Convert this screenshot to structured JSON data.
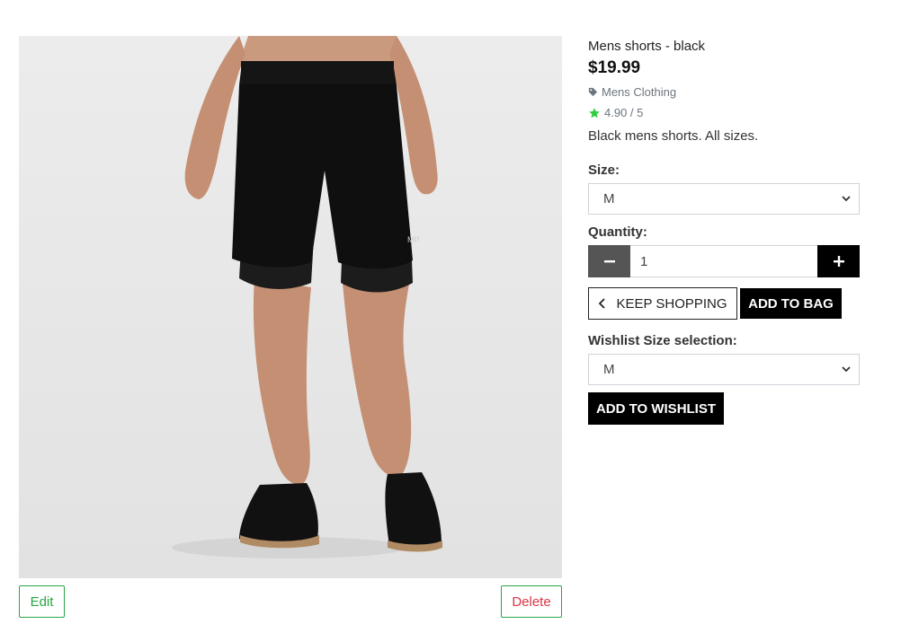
{
  "product": {
    "name": "Mens shorts - black",
    "price": "$19.99",
    "category": "Mens Clothing",
    "rating": "4.90 / 5",
    "description": "Black mens shorts. All sizes.",
    "image_icon": "product-photo"
  },
  "admin": {
    "edit_label": "Edit",
    "delete_label": "Delete"
  },
  "size": {
    "label": "Size:",
    "selected": "M"
  },
  "quantity": {
    "label": "Quantity:",
    "value": "1",
    "minus_icon": "minus-icon",
    "plus_icon": "plus-icon"
  },
  "actions": {
    "keep_shopping_label": "KEEP SHOPPING",
    "add_to_bag_label": "ADD TO BAG"
  },
  "wishlist": {
    "label": "Wishlist Size selection:",
    "selected": "M",
    "button_label": "ADD TO WISHLIST"
  },
  "colors": {
    "success": "#28a745",
    "danger": "#dc3545",
    "rating_star": "#2ecc40",
    "muted": "#6c757d",
    "dark_button": "#000000",
    "minus_button": "#555555"
  }
}
